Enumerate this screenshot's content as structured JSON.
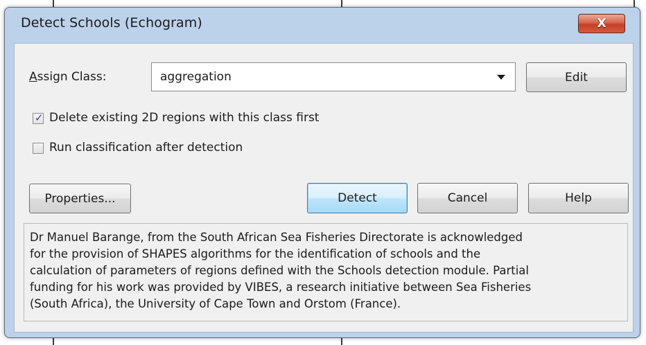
{
  "dialog": {
    "title": "Detect Schools (Echogram)",
    "close_glyph": "X"
  },
  "assign_class": {
    "label_accel": "A",
    "label_rest": "ssign Class:",
    "value": "aggregation",
    "edit_label": "Edit"
  },
  "options": {
    "delete_existing": {
      "label": "Delete existing 2D regions with this class first",
      "checked": true,
      "check_glyph": "✓"
    },
    "run_classification": {
      "label": "Run classification after detection",
      "checked": false
    }
  },
  "buttons": {
    "properties": "Properties...",
    "detect": "Detect",
    "cancel": "Cancel",
    "help": "Help"
  },
  "acknowledgement": [
    "Dr Manuel Barange, from the South African Sea Fisheries Directorate is acknowledged",
    "for the provision of SHAPES algorithms for the identification of schools and the",
    "calculation of parameters of regions defined with the Schools detection module. Partial",
    "funding for his work was provided by VIBES, a research initiative between Sea Fisheries",
    "(South Africa), the University of Cape Town and Orstom (France)."
  ],
  "icons": {
    "close": "close-icon",
    "dropdown": "chevron-down-icon",
    "checkmark": "checkmark-icon"
  },
  "colors": {
    "frame": "#bcd2ea",
    "client": "#f0f0f0",
    "close_button": "#c44029",
    "default_button": "#bee6fd"
  }
}
